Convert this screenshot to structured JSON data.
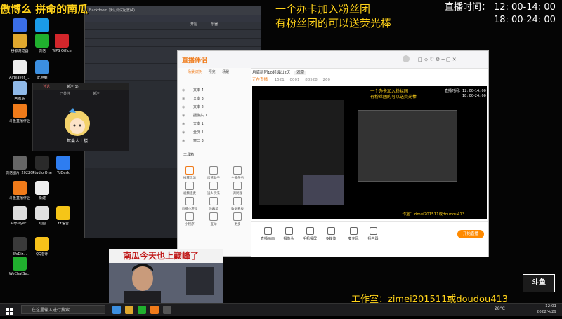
{
  "overlay": {
    "top_left": "傲博么 拼命的南瓜",
    "banner_line1": "一个办卡加入粉丝团",
    "banner_line2": "有粉丝团的可以送荧光棒",
    "live_time_label": "直播时间：",
    "live_time_1": "12: 00-14: 00",
    "live_time_2": "18: 00-24: 00",
    "studio": "工作室：zimei201511或doudou413",
    "cam_sign": "南瓜今天也上巅峰了",
    "anime_caption": "驾乘人上楼",
    "douyu_logo": "斗鱼"
  },
  "desktop_icons": [
    {
      "label": "驱动管理",
      "color": "#3a6ee8"
    },
    {
      "label": "腾讯QQ",
      "color": "#1a9be8"
    },
    {
      "label": "谷歌浏览器",
      "color": "#e0a82e"
    },
    {
      "label": "微信",
      "color": "#20b02e"
    },
    {
      "label": "WPS Office",
      "color": "#d2262b"
    },
    {
      "label": "Airplayer_...",
      "color": "#eeeeee"
    },
    {
      "label": "此电脑",
      "color": "#3c8fe0"
    },
    {
      "label": "回收站",
      "color": "#8fb9e8"
    },
    {
      "label": "斗鱼直播伴侣",
      "color": "#f07b1a"
    },
    {
      "label": "微信图片_2022040...",
      "color": "#666666"
    },
    {
      "label": "Studio One",
      "color": "#2a2a2a"
    },
    {
      "label": "ToDesk",
      "color": "#2e7df0"
    },
    {
      "label": "斗鱼直播伴侣",
      "color": "#f07b1a"
    },
    {
      "label": "新建",
      "color": "#eeeeee"
    },
    {
      "label": "Airplayer...",
      "color": "#dddddd"
    },
    {
      "label": "截图",
      "color": "#e0e0e0"
    },
    {
      "label": "YY语音",
      "color": "#f5c518"
    },
    {
      "label": "EfsDiz...",
      "color": "#3a3a3a"
    },
    {
      "label": "QQ音乐",
      "color": "#f7c21a"
    },
    {
      "label": "WeChatSe...",
      "color": "#20b02e"
    }
  ],
  "daw": {
    "title": "Backdoom.默认调试配置(4)",
    "menu": [
      "开始",
      "乐器"
    ]
  },
  "popup": {
    "tabs": [
      "讨论",
      "已关注",
      "关注"
    ],
    "count": "关注(1)"
  },
  "live_companion": {
    "logo": "直播伴侣",
    "room_title": "月底新团10超级出2天",
    "badge": "观赏",
    "status": "正在直播",
    "stats": [
      "1521",
      "0001",
      "88528",
      "260"
    ],
    "left_tabs": [
      "场景切换",
      "预览",
      "场景"
    ],
    "sources": [
      "文本 4",
      "文本 3",
      "文本 2",
      "摄像头 1",
      "文本 1",
      "全屏 1",
      "窗口 3"
    ],
    "tools_header": "工具箱",
    "tools": [
      "推荐玩法",
      "房管助手",
      "主播任务",
      "视频连麦",
      "送人玩法",
      "调试器",
      "直播小游戏",
      "弹幕墙",
      "数据看板",
      "小程序",
      "互动",
      "更多"
    ],
    "bottom_items": [
      "直播画面",
      "摄像头",
      "手机投屏",
      "多媒体",
      "麦克风",
      "扬声器"
    ],
    "start_button": "开始直播",
    "preview_banner1": "一个办卡加入粉丝团",
    "preview_banner2": "有粉丝团的可以送荧光棒",
    "preview_time_label": "直播时间：",
    "preview_time_1": "12: 00-14: 00",
    "preview_time_2": "18: 00-24: 00",
    "preview_studio": "工作室：zimei201511或doudou413"
  },
  "taskbar": {
    "search_placeholder": "在这里输入进行搜索",
    "weather": "28°C",
    "time": "12:01",
    "date": "2022/4/29"
  }
}
